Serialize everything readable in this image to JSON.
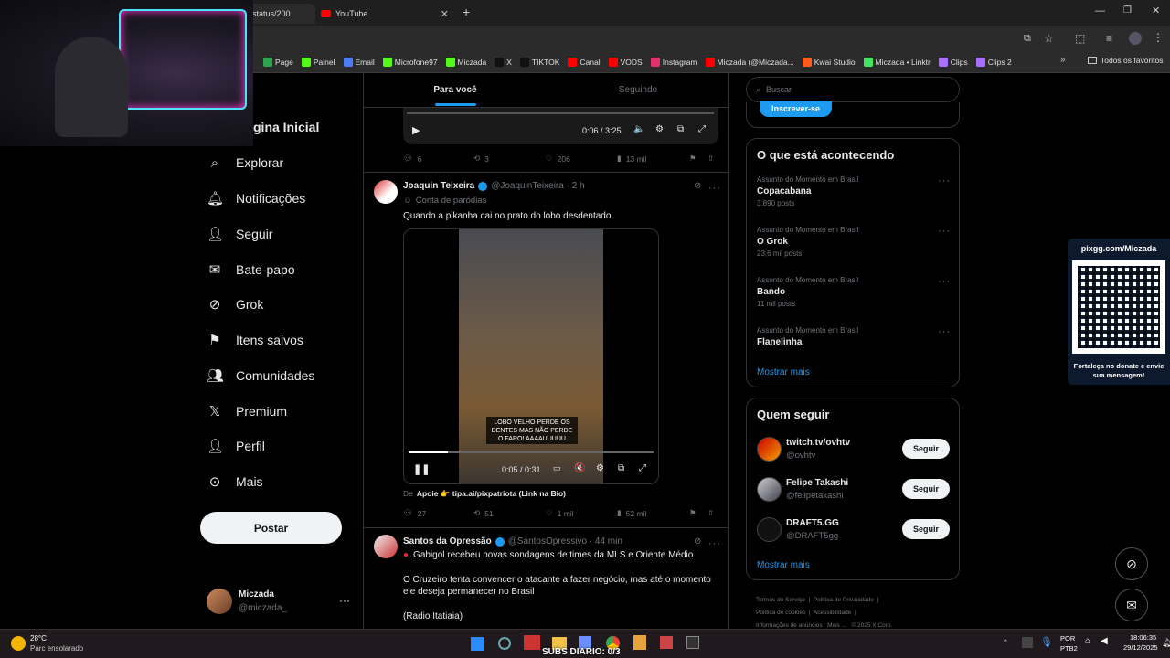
{
  "browser": {
    "tabs": [
      {
        "label": "status/200",
        "active": true
      },
      {
        "label": "YouTube",
        "active": false
      }
    ],
    "new_tab_icon": "plus-icon",
    "bookmarks": [
      {
        "label": "Page",
        "color": "#2ea44f"
      },
      {
        "label": "Painel",
        "color": "#53fc18"
      },
      {
        "label": "Email",
        "color": "#4a7cf6"
      },
      {
        "label": "Microfone97",
        "color": "#53fc18"
      },
      {
        "label": "Miczada",
        "color": "#53fc18"
      },
      {
        "label": "X",
        "color": "#111111"
      },
      {
        "label": "TIKTOK",
        "color": "#111111"
      },
      {
        "label": "Canal",
        "color": "#ff0000"
      },
      {
        "label": "VODS",
        "color": "#ff0000"
      },
      {
        "label": "Instagram",
        "color": "#e1306c"
      },
      {
        "label": "Miczada (@Miczada...",
        "color": "#ff0000"
      },
      {
        "label": "Kwai Studio",
        "color": "#ff5a1f"
      },
      {
        "label": "Miczada • Linktr",
        "color": "#43e55e"
      },
      {
        "label": "Clips",
        "color": "#a970ff"
      },
      {
        "label": "Clips 2",
        "color": "#a970ff"
      }
    ],
    "all_favorites": "Todos os favoritos"
  },
  "sidebar": {
    "home_partial": "gina Inicial",
    "items": [
      {
        "label": "Explorar",
        "icon": "search-icon"
      },
      {
        "label": "Notificações",
        "icon": "bell-icon"
      },
      {
        "label": "Seguir",
        "icon": "person-add-icon"
      },
      {
        "label": "Bate-papo",
        "icon": "mail-icon"
      },
      {
        "label": "Grok",
        "icon": "grok-icon"
      },
      {
        "label": "Itens salvos",
        "icon": "bookmark-icon"
      },
      {
        "label": "Comunidades",
        "icon": "people-icon"
      },
      {
        "label": "Premium",
        "icon": "x-logo-icon"
      },
      {
        "label": "Perfil",
        "icon": "person-icon"
      },
      {
        "label": "Mais",
        "icon": "more-circle-icon"
      }
    ],
    "post_button": "Postar",
    "account": {
      "name": "Miczada",
      "handle": "@miczada_"
    }
  },
  "feed": {
    "tabs": [
      "Para você",
      "Seguindo"
    ],
    "top_video": {
      "time": "0:06 / 3:25"
    },
    "top_actions": {
      "replies": "6",
      "reposts": "3",
      "likes": "206",
      "views": "13 mil"
    },
    "tweet1": {
      "name": "Joaquin Teixeira",
      "handle": "@JoaquinTeixeira · 2 h",
      "label": "Conta de paródias",
      "text": "Quando a pikanha cai no prato do lobo desdentado",
      "video_caption": "LOBO VELHO PERDE OS DENTES MAS NÃO PERDE O FARO! AAAAUUUUU",
      "time": "0:05 / 0:31",
      "video_progress": 0.16,
      "from_prefix": "De",
      "from_link": "Apoie 👉 tipa.ai/pixpatriota (Link na Bio)",
      "actions": {
        "replies": "27",
        "reposts": "51",
        "likes": "1 mil",
        "views": "52 mil"
      }
    },
    "tweet2": {
      "name": "Santos da Opressão",
      "handle": "@SantosOpressivo · 44 min",
      "line1": "Gabigol recebeu novas sondagens de times da MLS e Oriente Médio",
      "line2": "O Cruzeiro tenta convencer o atacante a fazer negócio, mas até o momento ele deseja permanecer no Brasil",
      "line3": "(Radio Itatiaia)"
    }
  },
  "right": {
    "search_placeholder": "Buscar",
    "subscribe": "Inscrever-se",
    "trending_title": "O que está acontecendo",
    "trends": [
      {
        "category": "Assunto do Momento em Brasil",
        "name": "Copacabana",
        "count": "3.890 posts"
      },
      {
        "category": "Assunto do Momento em Brasil",
        "name": "O Grok",
        "count": "23,6 mil posts"
      },
      {
        "category": "Assunto do Momento em Brasil",
        "name": "Bando",
        "count": "11 mil posts"
      },
      {
        "category": "Assunto do Momento em Brasil",
        "name": "Flanelinha",
        "count": ""
      }
    ],
    "show_more": "Mostrar mais",
    "follow_title": "Quem seguir",
    "follow": [
      {
        "name": "twitch.tv/ovhtv",
        "handle": "@ovhtv",
        "button": "Seguir"
      },
      {
        "name": "Felipe Takashi",
        "handle": "@felipetakashi",
        "button": "Seguir"
      },
      {
        "name": "DRAFT5.GG",
        "handle": "@DRAFT5gg",
        "button": "Seguir"
      }
    ],
    "footer": [
      "Termos de Serviço",
      "Política de Privacidade",
      "Política de cookies",
      "Acessibilidade",
      "Informações de anúncios",
      "Mais ...",
      "© 2025 X Corp."
    ]
  },
  "overlay": {
    "pix_title": "pixgg.com/Miczada",
    "pix_text": "Fortaleça no donate e envie sua mensagem!"
  },
  "taskbar": {
    "temp": "28°C",
    "weather": "Parc ensolarado",
    "subs": "SUBS DIARIO: 0/3",
    "lang": "POR",
    "layout": "PTB2",
    "time": "18:06:35",
    "date": "29/12/2025"
  }
}
